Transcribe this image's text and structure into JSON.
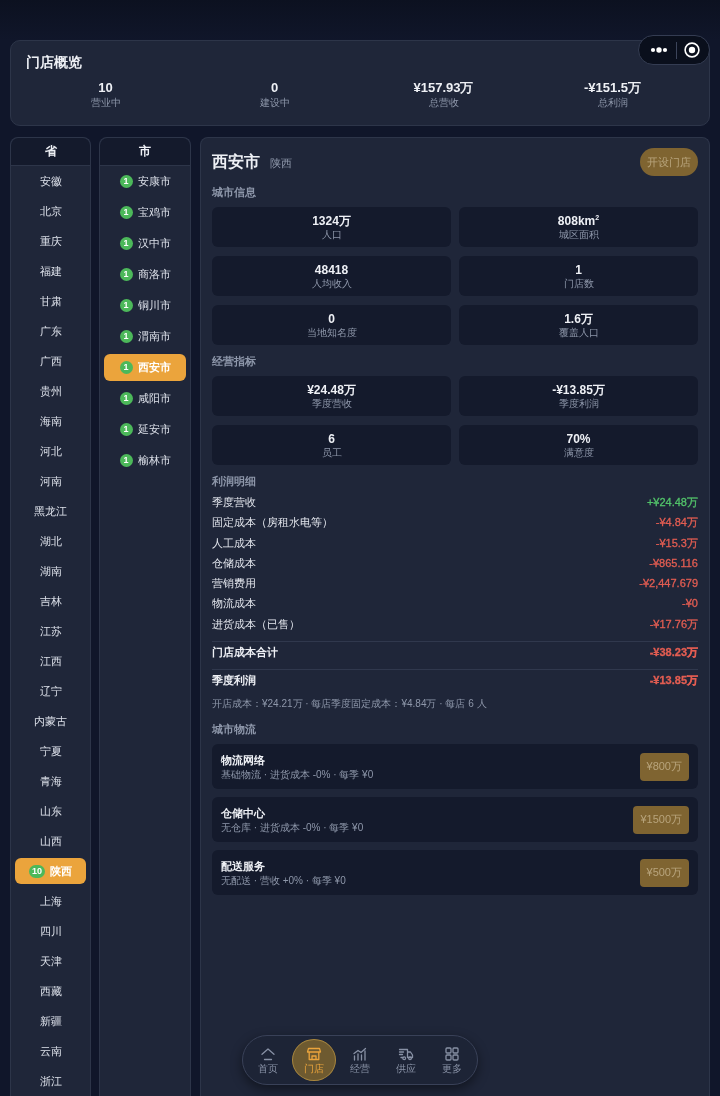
{
  "overview": {
    "title": "门店概览",
    "stats": [
      {
        "value": "10",
        "label": "营业中"
      },
      {
        "value": "0",
        "label": "建设中"
      },
      {
        "value": "¥157.93万",
        "label": "总营收"
      },
      {
        "value": "-¥151.5万",
        "label": "总利润"
      }
    ]
  },
  "provinces": {
    "header": "省",
    "items": [
      {
        "name": "安徽",
        "selected": false
      },
      {
        "name": "北京",
        "selected": false
      },
      {
        "name": "重庆",
        "selected": false
      },
      {
        "name": "福建",
        "selected": false
      },
      {
        "name": "甘肃",
        "selected": false
      },
      {
        "name": "广东",
        "selected": false
      },
      {
        "name": "广西",
        "selected": false
      },
      {
        "name": "贵州",
        "selected": false
      },
      {
        "name": "海南",
        "selected": false
      },
      {
        "name": "河北",
        "selected": false
      },
      {
        "name": "河南",
        "selected": false
      },
      {
        "name": "黑龙江",
        "selected": false
      },
      {
        "name": "湖北",
        "selected": false
      },
      {
        "name": "湖南",
        "selected": false
      },
      {
        "name": "吉林",
        "selected": false
      },
      {
        "name": "江苏",
        "selected": false
      },
      {
        "name": "江西",
        "selected": false
      },
      {
        "name": "辽宁",
        "selected": false
      },
      {
        "name": "内蒙古",
        "selected": false
      },
      {
        "name": "宁夏",
        "selected": false
      },
      {
        "name": "青海",
        "selected": false
      },
      {
        "name": "山东",
        "selected": false
      },
      {
        "name": "山西",
        "selected": false
      },
      {
        "name": "陕西",
        "badge": "10",
        "selected": true
      },
      {
        "name": "上海",
        "selected": false
      },
      {
        "name": "四川",
        "selected": false
      },
      {
        "name": "天津",
        "selected": false
      },
      {
        "name": "西藏",
        "selected": false
      },
      {
        "name": "新疆",
        "selected": false
      },
      {
        "name": "云南",
        "selected": false
      },
      {
        "name": "浙江",
        "selected": false
      }
    ]
  },
  "cities": {
    "header": "市",
    "items": [
      {
        "name": "安康市",
        "badge": "1",
        "selected": false
      },
      {
        "name": "宝鸡市",
        "badge": "1",
        "selected": false
      },
      {
        "name": "汉中市",
        "badge": "1",
        "selected": false
      },
      {
        "name": "商洛市",
        "badge": "1",
        "selected": false
      },
      {
        "name": "铜川市",
        "badge": "1",
        "selected": false
      },
      {
        "name": "渭南市",
        "badge": "1",
        "selected": false
      },
      {
        "name": "西安市",
        "badge": "1",
        "selected": true
      },
      {
        "name": "咸阳市",
        "badge": "1",
        "selected": false
      },
      {
        "name": "延安市",
        "badge": "1",
        "selected": false
      },
      {
        "name": "榆林市",
        "badge": "1",
        "selected": false
      }
    ]
  },
  "detail": {
    "title": "西安市",
    "subtitle": "陕西",
    "action": {
      "label": "开设门店",
      "disabled": true
    },
    "city_info": {
      "title": "城市信息",
      "tiles": [
        {
          "value": "1324万",
          "label": "人口"
        },
        {
          "value": "808km$^{2}$",
          "label": "城区面积"
        },
        {
          "value": "48418",
          "label": "人均收入"
        },
        {
          "value": "1",
          "label": "门店数"
        },
        {
          "value": "0",
          "label": "当地知名度"
        },
        {
          "value": "1.6万",
          "label": "覆盖人口"
        }
      ]
    },
    "metrics": {
      "title": "经营指标",
      "tiles": [
        {
          "value": "¥24.48万",
          "label": "季度营收"
        },
        {
          "value": "-¥13.85万",
          "label": "季度利润"
        },
        {
          "value": "6",
          "label": "员工"
        },
        {
          "value": "70%",
          "label": "满意度"
        }
      ]
    },
    "profit": {
      "title": "利润明细",
      "rows": [
        {
          "kind": "line",
          "label": "季度营收",
          "amount": "+¥24.48万",
          "color": "#52c26a"
        },
        {
          "kind": "line",
          "label": "固定成本（房租水电等）",
          "amount": "-¥4.84万",
          "color": "#e35d52"
        },
        {
          "kind": "line",
          "label": "人工成本",
          "amount": "-¥15.3万",
          "color": "#e35d52"
        },
        {
          "kind": "line",
          "label": "仓储成本",
          "amount": "-¥865.116",
          "color": "#e35d52"
        },
        {
          "kind": "line",
          "label": "营销费用",
          "amount": "-¥2,447.679",
          "color": "#e35d52"
        },
        {
          "kind": "line",
          "label": "物流成本",
          "amount": "-¥0",
          "color": "#e35d52"
        },
        {
          "kind": "line",
          "label": "进货成本（已售）",
          "amount": "-¥17.76万",
          "color": "#e35d52"
        },
        {
          "kind": "total",
          "label": "门店成本合计",
          "amount": "-¥38.23万",
          "color": "#e35d52"
        },
        {
          "kind": "total",
          "label": "季度利润",
          "amount": "-¥13.85万",
          "color": "#e35d52"
        }
      ],
      "note": "开店成本：¥24.21万 · 每店季度固定成本：¥4.84万 · 每店 6 人"
    },
    "logistics": {
      "title": "城市物流",
      "items": [
        {
          "name": "物流网络",
          "description": "基础物流 · 进货成本 -0% · 每季 ¥0",
          "price": "¥800万",
          "disabled": true
        },
        {
          "name": "仓储中心",
          "description": "无仓库 · 进货成本 -0% · 每季 ¥0",
          "price": "¥1500万",
          "disabled": true
        },
        {
          "name": "配送服务",
          "description": "无配送 · 营收 +0% · 每季 ¥0",
          "price": "¥500万",
          "disabled": true
        }
      ]
    }
  },
  "nav": [
    {
      "label": "首页",
      "selected": false
    },
    {
      "label": "门店",
      "selected": true
    },
    {
      "label": "经营",
      "selected": false
    },
    {
      "label": "供应",
      "selected": false
    },
    {
      "label": "更多",
      "selected": false
    }
  ]
}
